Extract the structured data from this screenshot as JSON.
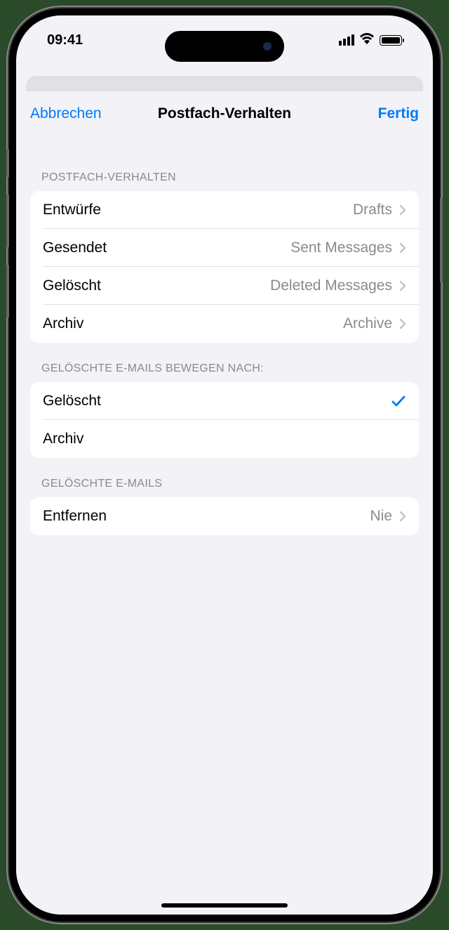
{
  "status": {
    "time": "09:41"
  },
  "nav": {
    "cancel": "Abbrechen",
    "title": "Postfach-Verhalten",
    "done": "Fertig"
  },
  "sections": {
    "behavior": {
      "header": "POSTFACH-VERHALTEN",
      "rows": [
        {
          "label": "Entwürfe",
          "value": "Drafts"
        },
        {
          "label": "Gesendet",
          "value": "Sent Messages"
        },
        {
          "label": "Gelöscht",
          "value": "Deleted Messages"
        },
        {
          "label": "Archiv",
          "value": "Archive"
        }
      ]
    },
    "moveDeleted": {
      "header": "GELÖSCHTE E-MAILS BEWEGEN NACH:",
      "rows": [
        {
          "label": "Gelöscht",
          "selected": true
        },
        {
          "label": "Archiv",
          "selected": false
        }
      ]
    },
    "deletedMails": {
      "header": "GELÖSCHTE E-MAILS",
      "rows": [
        {
          "label": "Entfernen",
          "value": "Nie"
        }
      ]
    }
  }
}
